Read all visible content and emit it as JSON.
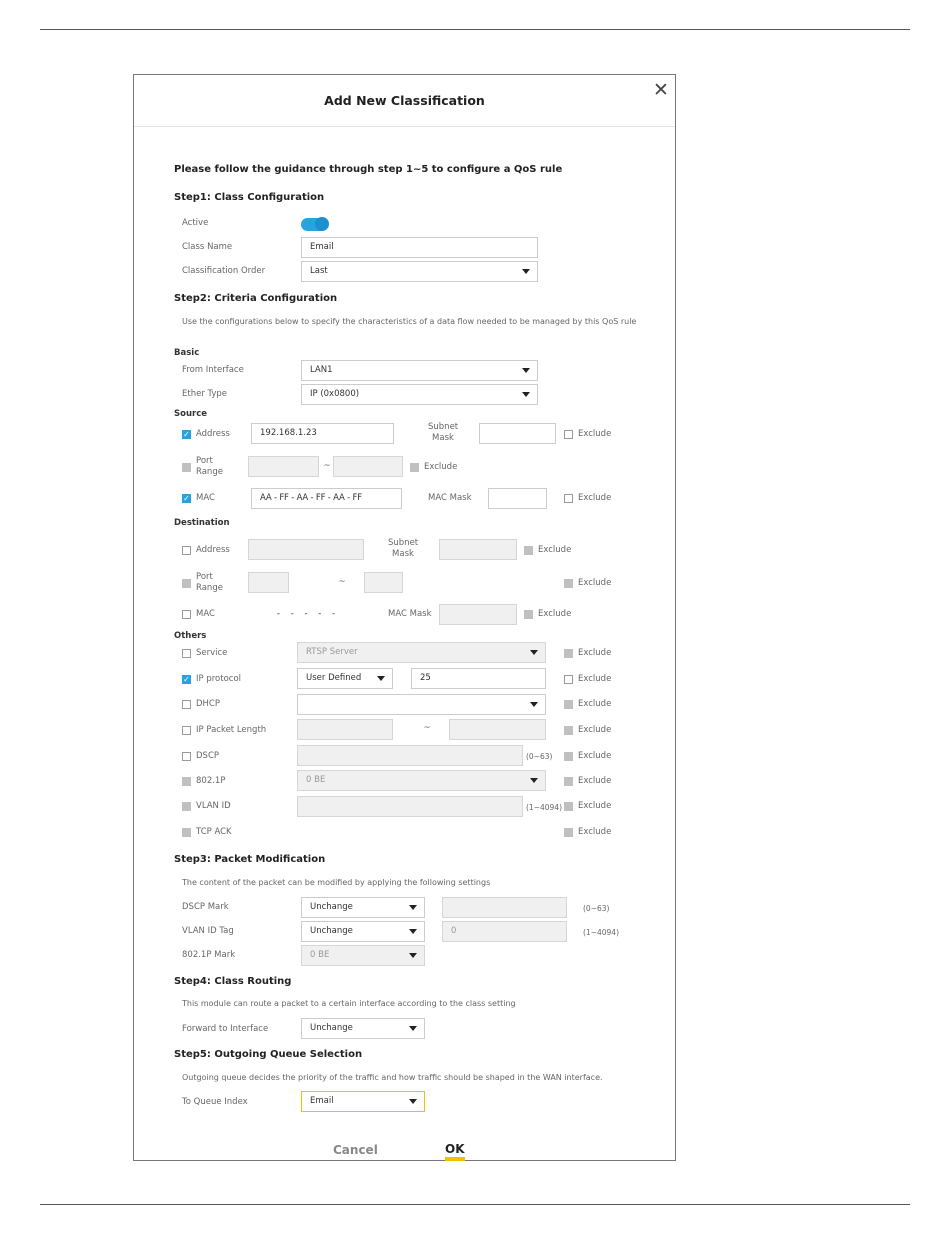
{
  "dialog": {
    "title": "Add New Classification",
    "close_icon": "close-icon"
  },
  "intro": "Please follow the guidance through step 1~5 to configure a QoS rule",
  "step1": {
    "heading": "Step1: Class Configuration",
    "active_label": "Active",
    "active": true,
    "class_name_label": "Class Name",
    "class_name_value": "Email",
    "order_label": "Classification Order",
    "order_value": "Last"
  },
  "step2": {
    "heading": "Step2: Criteria Configuration",
    "description": "Use the configurations below to specify the characteristics of a data flow needed to be managed by this QoS rule",
    "basic": {
      "title": "Basic",
      "from_interface_label": "From Interface",
      "from_interface_value": "LAN1",
      "ether_type_label": "Ether Type",
      "ether_type_value": "IP (0x0800)"
    },
    "source": {
      "title": "Source",
      "address_label": "Address",
      "address_value": "192.168.1.23",
      "subnet_mask_label": "Subnet Mask",
      "port_range_label": "Port Range",
      "mac_label": "MAC",
      "mac_value": "AA - FF - AA - FF - AA - FF",
      "mac_mask_label": "MAC Mask",
      "exclude_label": "Exclude",
      "range_sep": "~"
    },
    "destination": {
      "title": "Destination",
      "address_label": "Address",
      "subnet_mask_label": "Subnet Mask",
      "port_range_label": "Port Range",
      "mac_label": "MAC",
      "mac_value": "- - - - -",
      "mac_mask_label": "MAC Mask",
      "exclude_label": "Exclude",
      "range_sep": "~"
    },
    "others": {
      "title": "Others",
      "service_label": "Service",
      "service_value": "RTSP Server",
      "ip_protocol_label": "IP protocol",
      "ip_protocol_value": "User Defined",
      "ip_protocol_number": "25",
      "dhcp_label": "DHCP",
      "ip_packet_length_label": "IP Packet Length",
      "range_sep": "~",
      "dscp_label": "DSCP",
      "dscp_range": "(0~63)",
      "p8021_label": "802.1P",
      "p8021_value": "0 BE",
      "vlan_label": "VLAN ID",
      "vlan_range": "(1~4094)",
      "tcp_ack_label": "TCP ACK",
      "exclude_label": "Exclude"
    }
  },
  "step3": {
    "heading": "Step3: Packet Modification",
    "description": "The content of the packet can be modified by applying the following settings",
    "dscp_mark_label": "DSCP Mark",
    "dscp_mark_value": "Unchange",
    "dscp_range": "(0~63)",
    "vlan_tag_label": "VLAN ID Tag",
    "vlan_tag_value": "Unchange",
    "vlan_tag_input": "0",
    "vlan_range": "(1~4094)",
    "p8021_mark_label": "802.1P Mark",
    "p8021_mark_value": "0 BE"
  },
  "step4": {
    "heading": "Step4: Class Routing",
    "description": "This module can route a packet to a certain interface according to the class setting",
    "forward_label": "Forward to Interface",
    "forward_value": "Unchange"
  },
  "step5": {
    "heading": "Step5: Outgoing Queue Selection",
    "description": "Outgoing queue decides the priority of the traffic and how traffic should be shaped in the WAN interface.",
    "queue_label": "To Queue Index",
    "queue_value": "Email"
  },
  "buttons": {
    "cancel": "Cancel",
    "ok": "OK"
  },
  "colors": {
    "accent": "#29a3df",
    "highlight": "#f2c200"
  }
}
